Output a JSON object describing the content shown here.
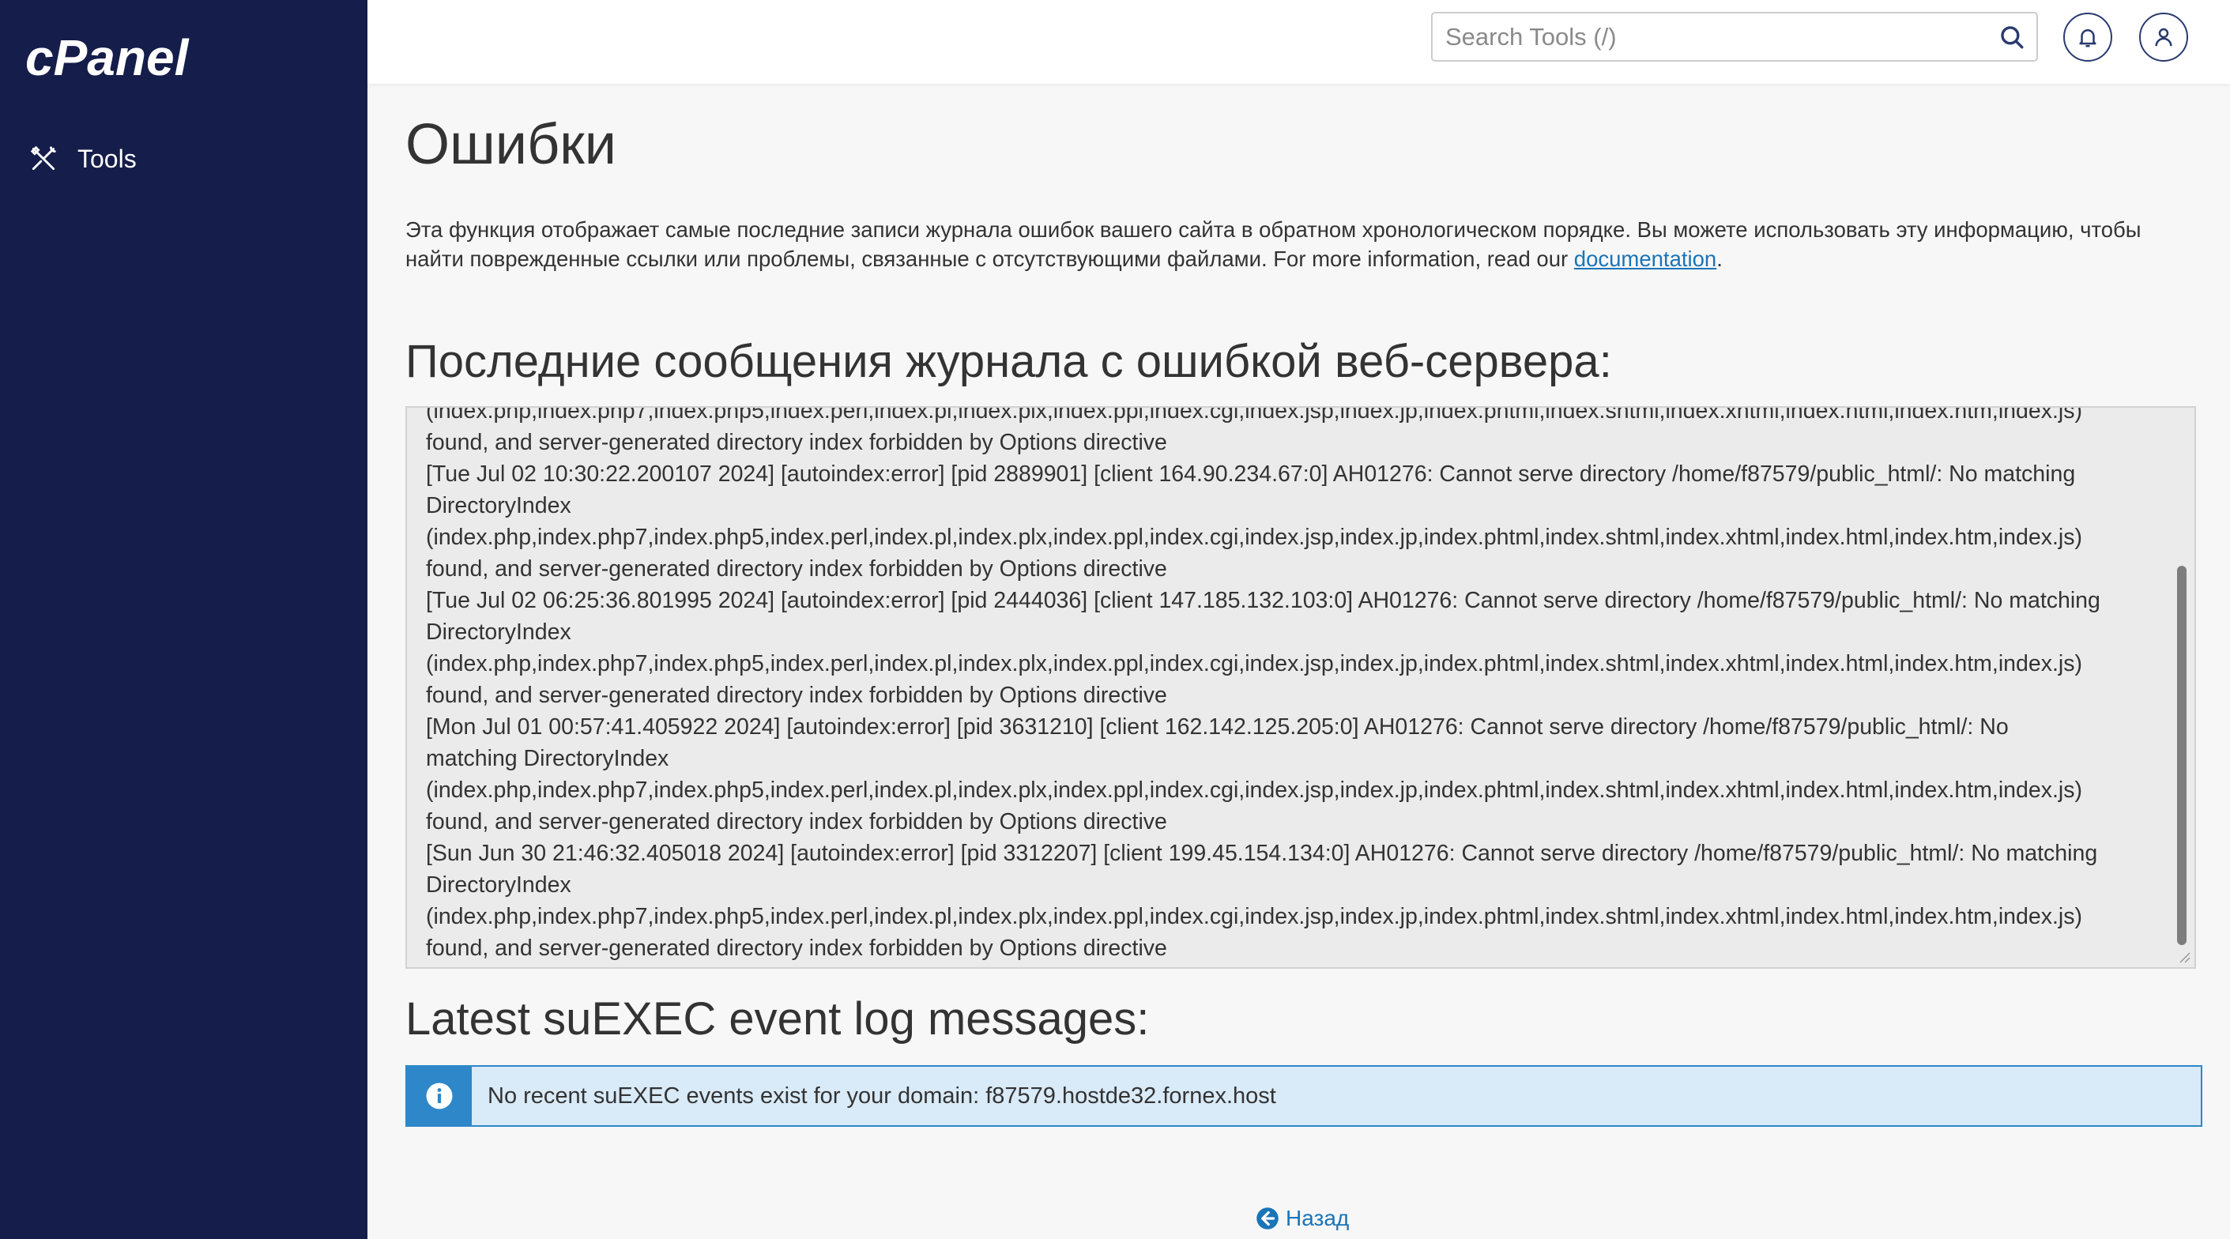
{
  "app": {
    "logo_text": "cPanel"
  },
  "sidebar": {
    "items": [
      {
        "label": "Tools",
        "icon": "tools-icon"
      }
    ]
  },
  "header": {
    "search": {
      "placeholder": "Search Tools (/)",
      "value": ""
    }
  },
  "main": {
    "title": "Ошибки",
    "description": "Эта функция отображает самые последние записи журнала ошибок вашего сайта в обратном хронологическом порядке. Вы можете использовать эту информацию, чтобы найти поврежденные ссылки или проблемы, связанные с отсутствующими файлами. For more information, read our ",
    "description_link": "documentation",
    "description_end": ".",
    "error_log_title": "Последние сообщения журнала с ошибкой веб-сервера:",
    "error_log_text": "(index.php,index.php7,index.php5,index.perl,index.pl,index.plx,index.ppl,index.cgi,index.jsp,index.jp,index.phtml,index.shtml,index.xhtml,index.html,index.htm,index.js)\nfound, and server-generated directory index forbidden by Options directive\n[Tue Jul 02 10:30:22.200107 2024] [autoindex:error] [pid 2889901] [client 164.90.234.67:0] AH01276: Cannot serve directory /home/f87579/public_html/: No matching\nDirectoryIndex\n(index.php,index.php7,index.php5,index.perl,index.pl,index.plx,index.ppl,index.cgi,index.jsp,index.jp,index.phtml,index.shtml,index.xhtml,index.html,index.htm,index.js)\nfound, and server-generated directory index forbidden by Options directive\n[Tue Jul 02 06:25:36.801995 2024] [autoindex:error] [pid 2444036] [client 147.185.132.103:0] AH01276: Cannot serve directory /home/f87579/public_html/: No matching\nDirectoryIndex\n(index.php,index.php7,index.php5,index.perl,index.pl,index.plx,index.ppl,index.cgi,index.jsp,index.jp,index.phtml,index.shtml,index.xhtml,index.html,index.htm,index.js)\nfound, and server-generated directory index forbidden by Options directive\n[Mon Jul 01 00:57:41.405922 2024] [autoindex:error] [pid 3631210] [client 162.142.125.205:0] AH01276: Cannot serve directory /home/f87579/public_html/: No\nmatching DirectoryIndex\n(index.php,index.php7,index.php5,index.perl,index.pl,index.plx,index.ppl,index.cgi,index.jsp,index.jp,index.phtml,index.shtml,index.xhtml,index.html,index.htm,index.js)\nfound, and server-generated directory index forbidden by Options directive\n[Sun Jun 30 21:46:32.405018 2024] [autoindex:error] [pid 3312207] [client 199.45.154.134:0] AH01276: Cannot serve directory /home/f87579/public_html/: No matching\nDirectoryIndex\n(index.php,index.php7,index.php5,index.perl,index.pl,index.plx,index.ppl,index.cgi,index.jsp,index.jp,index.phtml,index.shtml,index.xhtml,index.html,index.htm,index.js)\nfound, and server-generated directory index forbidden by Options directive",
    "suexec_title": "Latest suEXEC event log messages:",
    "suexec_alert": "No recent suEXEC events exist for your domain: f87579.hostde32.fornex.host",
    "back_label": "Назад"
  },
  "colors": {
    "sidebar_bg": "#151d4a",
    "link": "#1a74b8",
    "info_accent": "#2e87c8",
    "info_bg": "#d9eaf8"
  }
}
